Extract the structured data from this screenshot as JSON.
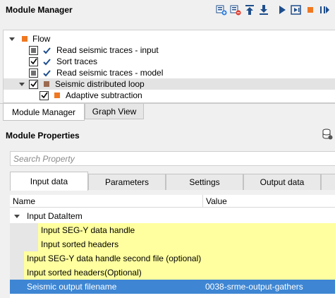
{
  "module_manager": {
    "title": "Module Manager",
    "toolbar_icons": [
      "add-module-icon",
      "remove-module-icon",
      "move-up-icon",
      "move-down-icon",
      "run-icon",
      "run-step-icon",
      "stop-icon",
      "play-from-icon"
    ]
  },
  "tree": {
    "flow_label": "Flow",
    "items": [
      {
        "label": "Read seismic traces - input",
        "state": "grey-check"
      },
      {
        "label": "Sort traces",
        "state": "checked"
      },
      {
        "label": "Read seismic traces - model",
        "state": "grey-check"
      },
      {
        "label": "Seismic distributed loop",
        "state": "checked"
      },
      {
        "label": "Adaptive subtraction",
        "state": "checked"
      }
    ]
  },
  "bottom_tabs": [
    "Module Manager",
    "Graph View"
  ],
  "module_properties": {
    "title": "Module Properties",
    "search_placeholder": "Search Property",
    "tabs": [
      "Input data",
      "Parameters",
      "Settings",
      "Output data"
    ],
    "columns": {
      "name": "Name",
      "value": "Value"
    },
    "group_label": "Input DataItem",
    "rows": [
      {
        "name": "Input SEG-Y data handle",
        "value": ""
      },
      {
        "name": "Input sorted headers",
        "value": ""
      },
      {
        "name": "Input SEG-Y data handle second file (optional)",
        "value": ""
      },
      {
        "name": "Input sorted headers(Optional)",
        "value": ""
      },
      {
        "name": "Seismic output filename",
        "value": "0038-srme-output-gathers"
      }
    ]
  },
  "colors": {
    "accent_orange": "#f07821",
    "selection_blue": "#3e86d3",
    "highlight_yellow": "#ffff9f"
  }
}
